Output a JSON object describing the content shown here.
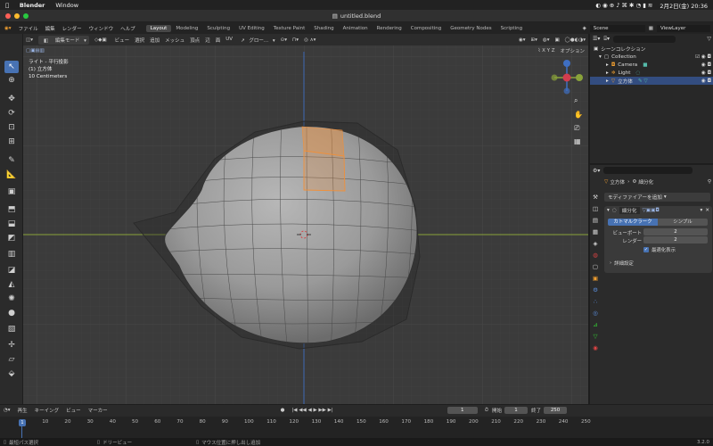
{
  "macbar": {
    "apple": "",
    "app": "Blender",
    "menu_window": "Window",
    "datetime": "2月2日(金) 20:36"
  },
  "title": "untitled.blend",
  "header": {
    "menus": [
      "ファイル",
      "編集",
      "レンダー",
      "ウィンドウ",
      "ヘルプ"
    ],
    "workspaces": [
      "Layout",
      "Modeling",
      "Sculpting",
      "UV Editing",
      "Texture Paint",
      "Shading",
      "Animation",
      "Rendering",
      "Compositing",
      "Geometry Nodes",
      "Scripting"
    ],
    "active_workspace": "Layout",
    "scene": "Scene",
    "view_layer": "ViewLayer"
  },
  "viewport_header": {
    "mode": "編集モード",
    "menus": [
      "ビュー",
      "選択",
      "追加",
      "メッシュ",
      "頂点",
      "辺",
      "面",
      "UV"
    ],
    "transform": "グロー...",
    "options": "オプション"
  },
  "overlay": {
    "line1": "ライト - 平行投影",
    "line2": "(1) 立方体",
    "line3": "10 Centimeters"
  },
  "outliner": {
    "root": "シーンコレクション",
    "items": [
      {
        "label": "Collection"
      },
      {
        "label": "Camera"
      },
      {
        "label": "Light"
      },
      {
        "label": "立方体"
      }
    ]
  },
  "properties": {
    "breadcrumb_object": "立方体",
    "breadcrumb_modifier": "細分化",
    "add_modifier": "モディファイアーを追加",
    "modifier_name": "細分化",
    "btn_catmull": "カトマルクラーク",
    "btn_simple": "シンプル",
    "viewport_label": "ビューポート",
    "viewport_value": "2",
    "render_label": "レンダー",
    "render_value": "2",
    "optimal_label": "最適化表示",
    "advanced_label": "詳細設定"
  },
  "timeline": {
    "menus": [
      "再生",
      "キーイング",
      "ビュー",
      "マーカー"
    ],
    "current_frame": "1",
    "start_label": "開始",
    "start_value": "1",
    "end_label": "終了",
    "end_value": "250",
    "ticks": [
      "1",
      "10",
      "20",
      "30",
      "40",
      "50",
      "60",
      "70",
      "80",
      "90",
      "100",
      "110",
      "120",
      "130",
      "140",
      "150",
      "160",
      "170",
      "180",
      "190",
      "200",
      "210",
      "220",
      "230",
      "240",
      "250"
    ]
  },
  "statusbar": {
    "left": "最短パス選択",
    "middle": "ドリービュー",
    "right": "マウス位置に押し出し追加",
    "version": "3.2.0"
  },
  "colors": {
    "accent": "#4772b3",
    "x_axis": "#8aa33a",
    "y_axis": "#3f6fc2",
    "selection": "#f0903a"
  }
}
